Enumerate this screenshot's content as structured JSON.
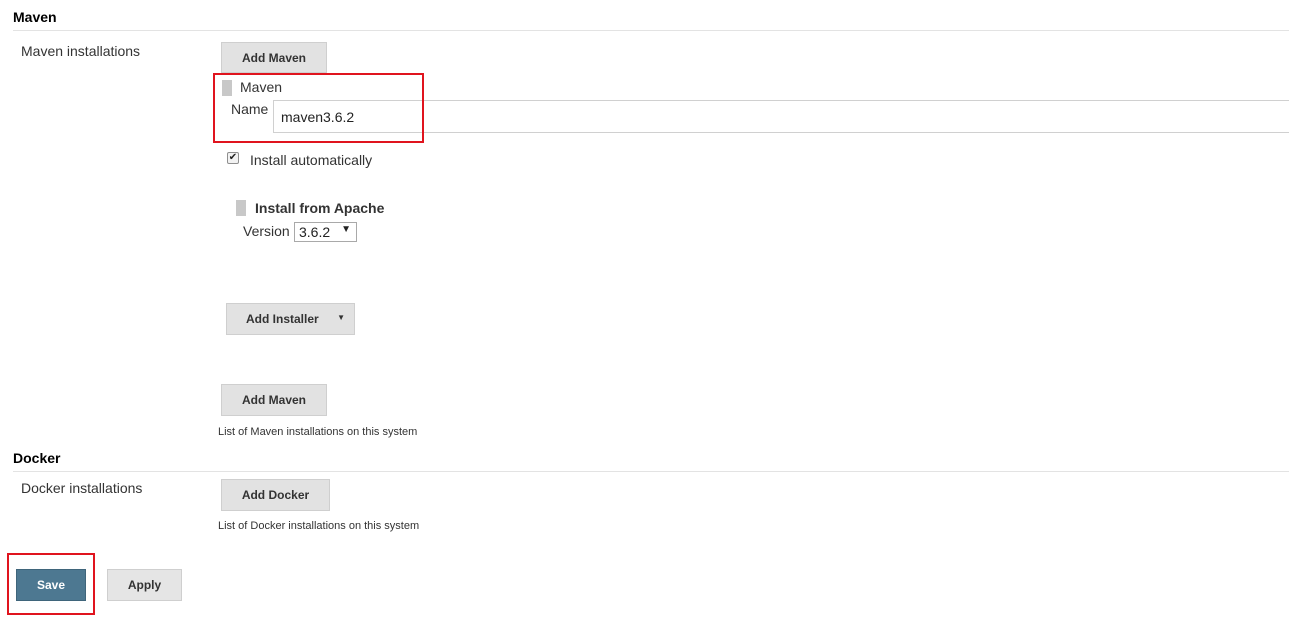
{
  "maven": {
    "section_title": "Maven",
    "installations_label": "Maven installations",
    "add_button_top": "Add Maven",
    "item": {
      "title": "Maven",
      "name_label": "Name",
      "name_value": "maven3.6.2",
      "install_automatically_label": "Install automatically",
      "install_automatically_checked": true,
      "installer": {
        "title": "Install from Apache",
        "version_label": "Version",
        "version_value": "3.6.2"
      },
      "add_installer_button": "Add Installer"
    },
    "add_button_bottom": "Add Maven",
    "help_text": "List of Maven installations on this system"
  },
  "docker": {
    "section_title": "Docker",
    "installations_label": "Docker installations",
    "add_button": "Add Docker",
    "help_text": "List of Docker installations on this system"
  },
  "footer": {
    "save_label": "Save",
    "apply_label": "Apply"
  },
  "icons": {
    "checkmark": "✔",
    "caret_down": "▼"
  },
  "colors": {
    "highlight": "#e0141e",
    "save_button": "#4d7891"
  }
}
